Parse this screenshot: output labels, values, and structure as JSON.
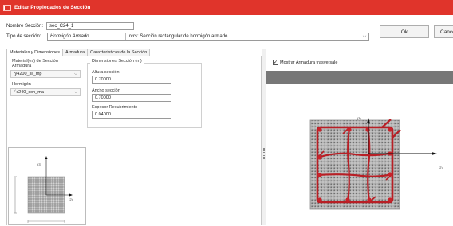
{
  "window": {
    "title": "Editar Propiedades de Sección"
  },
  "form": {
    "name_label": "Nombre Sección:",
    "name_value": "sec_C24_1",
    "type_label": "Tipo de sección:",
    "type_value": "Hormigón Armado",
    "type_code_value": "rcrs: Sección rectangular de hormigón armado"
  },
  "buttons": {
    "ok": "Ok",
    "cancel": "Cancel"
  },
  "tabs": [
    {
      "label": "Materiales y Dimensiones",
      "active": true
    },
    {
      "label": "Armadura",
      "active": false
    },
    {
      "label": "Características de la Sección",
      "active": false
    }
  ],
  "materials": {
    "heading": "Material(es) de Sección",
    "reinforcement_label": "Armadura",
    "reinforcement_value": "fy4200_sll_mp",
    "concrete_label": "Hormigón",
    "concrete_value": "f´c240_con_ma"
  },
  "dimensions": {
    "heading": "Dimensiones Sección (m)",
    "height_label": "Altura sección",
    "height_value": "0.70000",
    "width_label": "Ancho sección",
    "width_value": "0.70000",
    "cover_label": "Espesor Recubrimiento",
    "cover_value": "0.04000"
  },
  "preview_left": {
    "axis_3": "(3)",
    "axis_2": "(2)"
  },
  "preview_right": {
    "show_transverse_label": "Mostrar Armadura trasversale",
    "show_transverse_checked": true,
    "axis_3": "(3)",
    "axis_2": "(2)"
  },
  "colors": {
    "title_bar": "#e0342b",
    "rebar": "#b81f25",
    "gray_bar": "#777777"
  }
}
